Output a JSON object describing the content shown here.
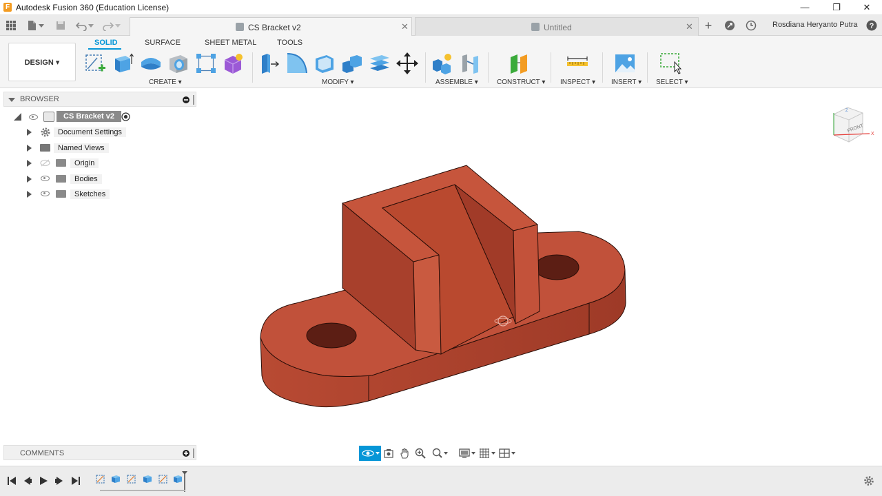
{
  "window": {
    "app_icon_letter": "F",
    "title": "Autodesk Fusion 360 (Education License)",
    "minimize": "—",
    "restore": "❐",
    "close": "✕"
  },
  "tabs": [
    {
      "label": "CS Bracket v2",
      "active": true
    },
    {
      "label": "Untitled",
      "active": false
    }
  ],
  "user": {
    "name": "Rosdiana Heryanto Putra"
  },
  "toolbar": {
    "workspace": "DESIGN",
    "workspace_tabs": [
      {
        "label": "SOLID",
        "active": true
      },
      {
        "label": "SURFACE",
        "active": false
      },
      {
        "label": "SHEET METAL",
        "active": false
      },
      {
        "label": "TOOLS",
        "active": false
      }
    ],
    "groups": {
      "create": "CREATE",
      "modify": "MODIFY",
      "assemble": "ASSEMBLE",
      "construct": "CONSTRUCT",
      "inspect": "INSPECT",
      "insert": "INSERT",
      "select": "SELECT"
    },
    "dropdown_glyph": "▾"
  },
  "browser": {
    "header": "BROWSER",
    "root": "CS Bracket v2",
    "items": [
      {
        "label": "Document Settings",
        "icon": "gear-icon"
      },
      {
        "label": "Named Views",
        "icon": "folder-icon"
      },
      {
        "label": "Origin",
        "icon": "folder-icon",
        "visible": false
      },
      {
        "label": "Bodies",
        "icon": "folder-icon",
        "visible": true
      },
      {
        "label": "Sketches",
        "icon": "folder-icon",
        "visible": true
      }
    ]
  },
  "viewcube": {
    "face_label": "FRONT",
    "axis_x": "X",
    "axis_z": "Z"
  },
  "comments": {
    "header": "COMMENTS"
  },
  "colors": {
    "accent": "#0696d7",
    "model_body": "#b5442f",
    "panel_bg": "#f0f0f0"
  }
}
